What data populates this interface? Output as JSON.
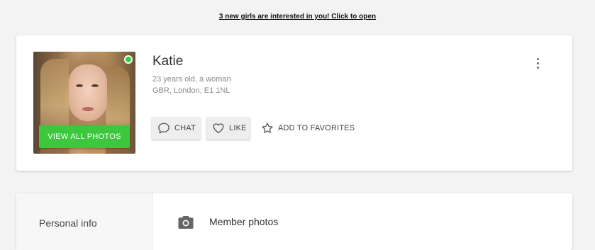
{
  "banner": {
    "text": "3 new girls are interested in you! Click to open"
  },
  "profile": {
    "name": "Katie",
    "age_gender": "23 years old, a woman",
    "location": "GBR, London, E1 1NL",
    "online": true,
    "view_photos_label": "VIEW ALL PHOTOS",
    "actions": {
      "chat": "CHAT",
      "like": "LIKE",
      "favorites": "ADD TO FAVORITES"
    },
    "more_menu_icon": "kebab-vertical-icon"
  },
  "sections": {
    "sidebar_item": "Personal info",
    "photos_heading": "Member photos",
    "photos_icon": "camera-icon"
  },
  "colors": {
    "accent_green": "#3cc83c",
    "online_green": "#3ec93e",
    "background": "#f3f3f3"
  }
}
